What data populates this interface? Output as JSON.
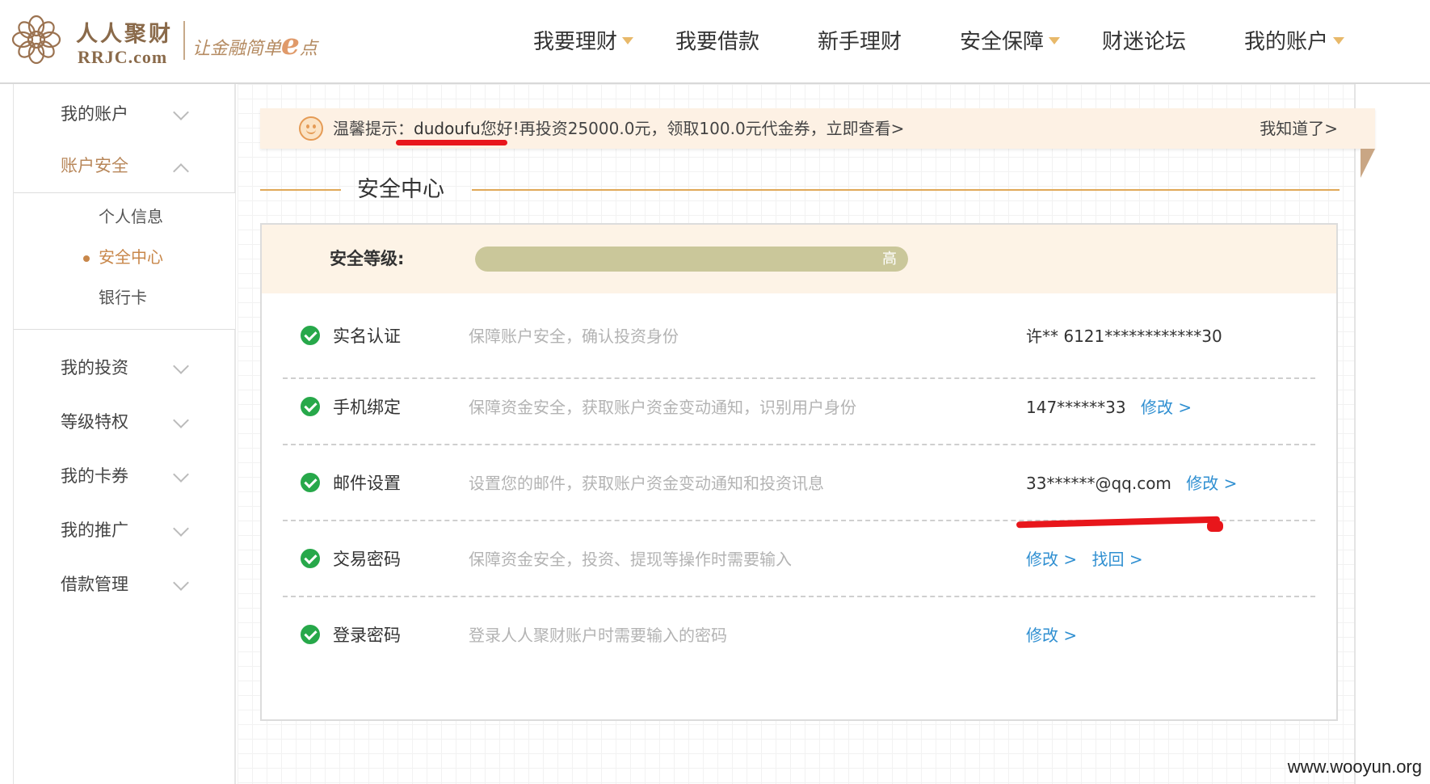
{
  "brand": {
    "name": "人人聚财",
    "domain": "RRJC.com",
    "slogan_prefix": "让金融简单",
    "slogan_e": "e",
    "slogan_suffix": "点"
  },
  "nav": [
    {
      "label": "我要理财",
      "has_dropdown": true
    },
    {
      "label": "我要借款",
      "has_dropdown": false
    },
    {
      "label": "新手理财",
      "has_dropdown": false
    },
    {
      "label": "安全保障",
      "has_dropdown": true
    },
    {
      "label": "财迷论坛",
      "has_dropdown": false
    },
    {
      "label": "我的账户",
      "has_dropdown": true
    }
  ],
  "sidebar": {
    "items": [
      {
        "label": "我的账户"
      },
      {
        "label": "账户安全"
      },
      {
        "label": "我的投资"
      },
      {
        "label": "等级特权"
      },
      {
        "label": "我的卡券"
      },
      {
        "label": "我的推广"
      },
      {
        "label": "借款管理"
      }
    ],
    "sub_items": [
      {
        "label": "个人信息"
      },
      {
        "label": "安全中心"
      },
      {
        "label": "银行卡"
      }
    ],
    "active_item": "账户安全",
    "active_sub_item": "安全中心"
  },
  "notice": {
    "prefix": "温馨提示：",
    "username": "dudoufu",
    "message": "您好!再投资25000.0元，领取100.0元代金券，立即查看>",
    "dismiss": "我知道了>"
  },
  "section_title": "安全中心",
  "security_level": {
    "label": "安全等级:",
    "value_text": "高",
    "progress": 1.0
  },
  "rows": [
    {
      "title": "实名认证",
      "desc": "保障账户安全，确认投资身份",
      "value": "许**  6121************30",
      "links": []
    },
    {
      "title": "手机绑定",
      "desc": "保障资金安全，获取账户资金变动通知，识别用户身份",
      "value": "147******33",
      "links": [
        "修改 >"
      ]
    },
    {
      "title": "邮件设置",
      "desc": "设置您的邮件，获取账户资金变动通知和投资讯息",
      "value": "33******@qq.com",
      "links": [
        "修改 >"
      ]
    },
    {
      "title": "交易密码",
      "desc": "保障资金安全，投资、提现等操作时需要输入",
      "value": "",
      "links": [
        "修改 >",
        "找回 >"
      ]
    },
    {
      "title": "登录密码",
      "desc": "登录人人聚财账户时需要输入的密码",
      "value": "",
      "links": [
        "修改 >"
      ]
    }
  ],
  "watermark": "www.wooyun.org",
  "colors": {
    "accent": "#e0a857",
    "link": "#2f8fd1",
    "check": "#27a84a",
    "notice_bg": "#fdf1e4",
    "annotation_red": "#e8161b"
  }
}
